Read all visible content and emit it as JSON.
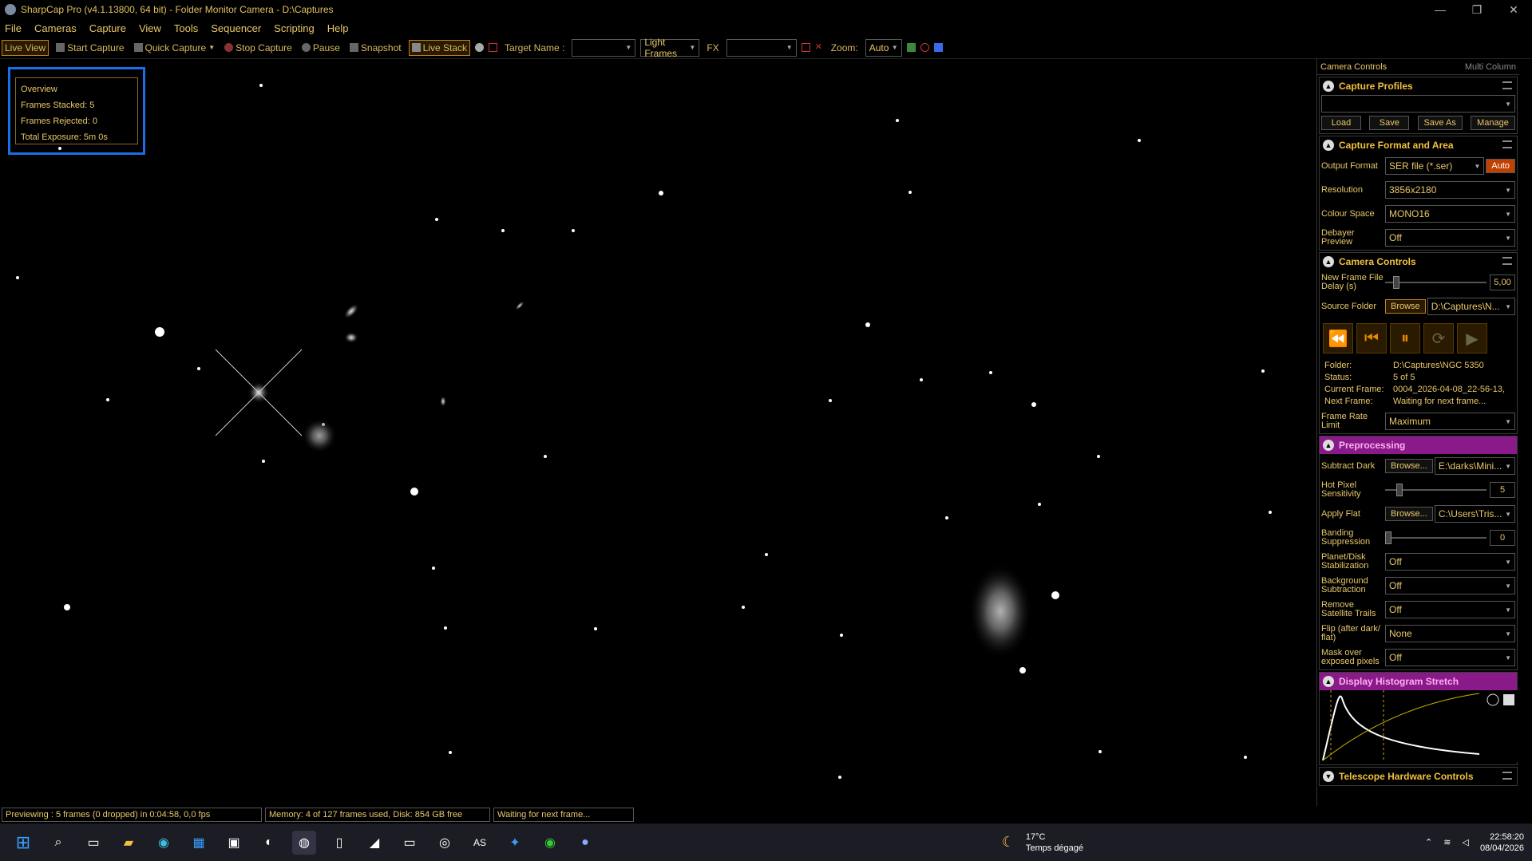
{
  "window": {
    "title": "SharpCap Pro (v4.1.13800, 64 bit) - Folder Monitor Camera - D:\\Captures"
  },
  "menu": [
    "File",
    "Cameras",
    "Capture",
    "View",
    "Tools",
    "Sequencer",
    "Scripting",
    "Help"
  ],
  "toolbar": {
    "live_view": "Live View",
    "start_capture": "Start Capture",
    "quick_capture": "Quick Capture",
    "stop_capture": "Stop Capture",
    "pause": "Pause",
    "snapshot": "Snapshot",
    "live_stack": "Live Stack",
    "target_name_label": "Target Name :",
    "frame_type": "Light Frames",
    "fx_label": "FX",
    "zoom_label": "Zoom:",
    "zoom_value": "Auto"
  },
  "overview": {
    "title": "Overview",
    "frames_stacked": "Frames Stacked:  5",
    "frames_rejected": "Frames Rejected: 0",
    "total_exposure": "Total Exposure:    5m 0s"
  },
  "panel": {
    "title": "Camera Controls",
    "multi_column": "Multi Column",
    "capture_profiles": {
      "title": "Capture Profiles",
      "load": "Load",
      "save": "Save",
      "save_as": "Save As",
      "manage": "Manage"
    },
    "format": {
      "title": "Capture Format and Area",
      "output_format_label": "Output Format",
      "output_format": "SER file (*.ser)",
      "auto": "Auto",
      "resolution_label": "Resolution",
      "resolution": "3856x2180",
      "colour_space_label": "Colour Space",
      "colour_space": "MONO16",
      "debayer_label": "Debayer Preview",
      "debayer": "Off"
    },
    "camera": {
      "title": "Camera Controls",
      "delay_label": "New Frame File Delay (s)",
      "delay": "5,00",
      "source_label": "Source Folder",
      "browse": "Browse",
      "source": "D:\\Captures\\N...",
      "folder_k": "Folder:",
      "folder_v": "D:\\Captures\\NGC 5350",
      "status_k": "Status:",
      "status_v": "5 of 5",
      "current_k": "Current Frame:",
      "current_v": "0004_2026-04-08_22-56-13,",
      "next_k": "Next Frame:",
      "next_v": "Waiting for next frame...",
      "frame_rate_label": "Frame Rate Limit",
      "frame_rate": "Maximum"
    },
    "pre": {
      "title": "Preprocessing",
      "dark_label": "Subtract Dark",
      "dark_browse": "Browse...",
      "dark": "E:\\darks\\Mini...",
      "hot_label": "Hot Pixel Sensitivity",
      "hot": "5",
      "flat_label": "Apply Flat",
      "flat_browse": "Browse...",
      "flat": "C:\\Users\\Tris...",
      "band_label": "Banding Suppression",
      "band": "0",
      "stab_label": "Planet/Disk Stabilization",
      "stab": "Off",
      "bg_label": "Background Subtraction",
      "bg": "Off",
      "sat_label": "Remove Satellite Trails",
      "sat": "Off",
      "flip_label": "Flip (after dark/ flat)",
      "flip": "None",
      "mask_label": "Mask over exposed pixels",
      "mask": "Off"
    },
    "histogram": {
      "title": "Display Histogram Stretch"
    },
    "telescope": {
      "title": "Telescope Hardware Controls"
    }
  },
  "status": {
    "preview": "Previewing : 5 frames (0 dropped) in 0:04:58, 0,0 fps",
    "memory": "Memory: 4 of 127 frames used, Disk: 854 GB free",
    "waiting": "Waiting for next frame..."
  },
  "taskbar": {
    "temp": "17°C",
    "weather": "Temps dégagé",
    "time": "22:58:20",
    "date": "08/04/2026"
  }
}
